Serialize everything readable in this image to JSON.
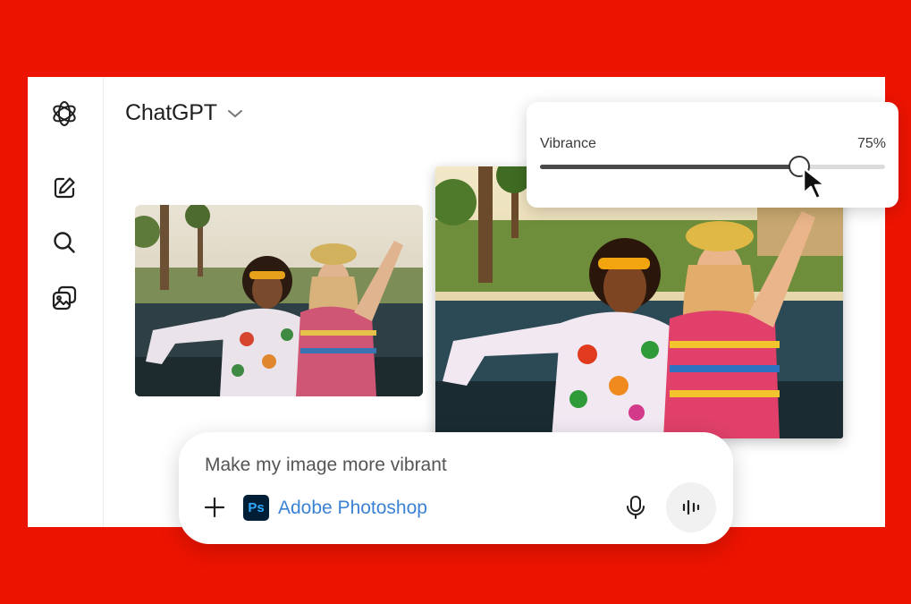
{
  "header": {
    "title": "ChatGPT"
  },
  "sidebar": {
    "icons": [
      "openai-logo-icon",
      "new-chat-icon",
      "search-icon",
      "images-icon"
    ]
  },
  "vibrance": {
    "label": "Vibrance",
    "value_text": "75%",
    "value": 0.75
  },
  "composer": {
    "input_text": "Make my image more vibrant",
    "app_chip": {
      "logo_text": "Ps",
      "label": "Adobe Photoshop"
    }
  },
  "colors": {
    "background": "#ec1300",
    "photoshop_blue": "#31a8ff",
    "photoshop_dark": "#001e36",
    "link_blue": "#3b82d4"
  }
}
